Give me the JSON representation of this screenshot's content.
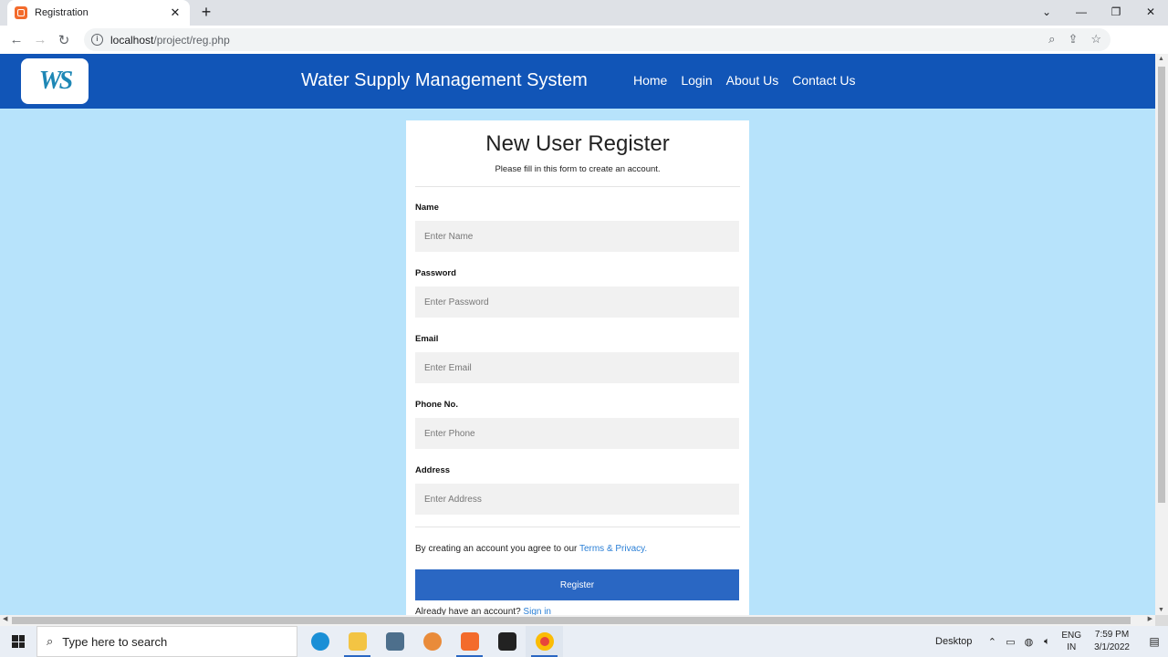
{
  "browser": {
    "tab_title": "Registration",
    "tab_close": "✕",
    "new_tab": "+",
    "url_host": "localhost",
    "url_path": "/project/reg.php",
    "window_controls": {
      "chevron": "⌄",
      "minimize": "—",
      "restore": "❐",
      "close": "✕"
    }
  },
  "site": {
    "logo_text": "WS",
    "title": "Water Supply Management System",
    "nav": [
      "Home",
      "Login",
      "About Us",
      "Contact Us"
    ]
  },
  "form": {
    "heading": "New User Register",
    "subheading": "Please fill in this form to create an account.",
    "fields": [
      {
        "label": "Name",
        "placeholder": "Enter Name"
      },
      {
        "label": "Password",
        "placeholder": "Enter Password"
      },
      {
        "label": "Email",
        "placeholder": "Enter Email"
      },
      {
        "label": "Phone No.",
        "placeholder": "Enter Phone"
      },
      {
        "label": "Address",
        "placeholder": "Enter Address"
      }
    ],
    "terms_text": "By creating an account you agree to our ",
    "terms_link": "Terms & Privacy.",
    "register_label": "Register",
    "signin_text": "Already have an account? ",
    "signin_link": "Sign in"
  },
  "taskbar": {
    "search_placeholder": "Type here to search",
    "desktop_label": "Desktop",
    "lang_line1": "ENG",
    "lang_line2": "IN",
    "time": "7:59 PM",
    "date": "3/1/2022"
  },
  "colors": {
    "header_bg": "#1155b7",
    "page_bg": "#b7e3fb",
    "button_bg": "#2a67c3",
    "link": "#2a7fd6"
  }
}
